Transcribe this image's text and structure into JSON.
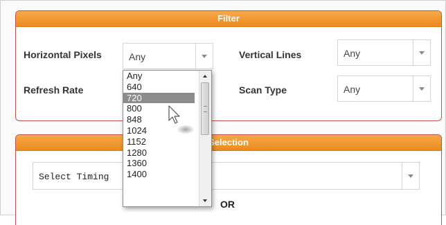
{
  "filter": {
    "header": "Filter",
    "horizontal_pixels": {
      "label": "Horizontal Pixels",
      "value": "Any"
    },
    "vertical_lines": {
      "label": "Vertical Lines",
      "value": "Any"
    },
    "refresh_rate": {
      "label": "Refresh Rate"
    },
    "scan_type": {
      "label": "Scan Type",
      "value": "Any"
    }
  },
  "dropdown": {
    "options": [
      "Any",
      "640",
      "720",
      "800",
      "848",
      "1024",
      "1152",
      "1280",
      "1360",
      "1400"
    ],
    "highlighted": "720"
  },
  "selection": {
    "header": "Selection",
    "timing_placeholder": "Select Timing",
    "or_label": "OR"
  },
  "colors": {
    "header_orange": "#ec8a1f",
    "panel_border": "#c0504d",
    "highlight_gray": "#8c8c8c"
  }
}
